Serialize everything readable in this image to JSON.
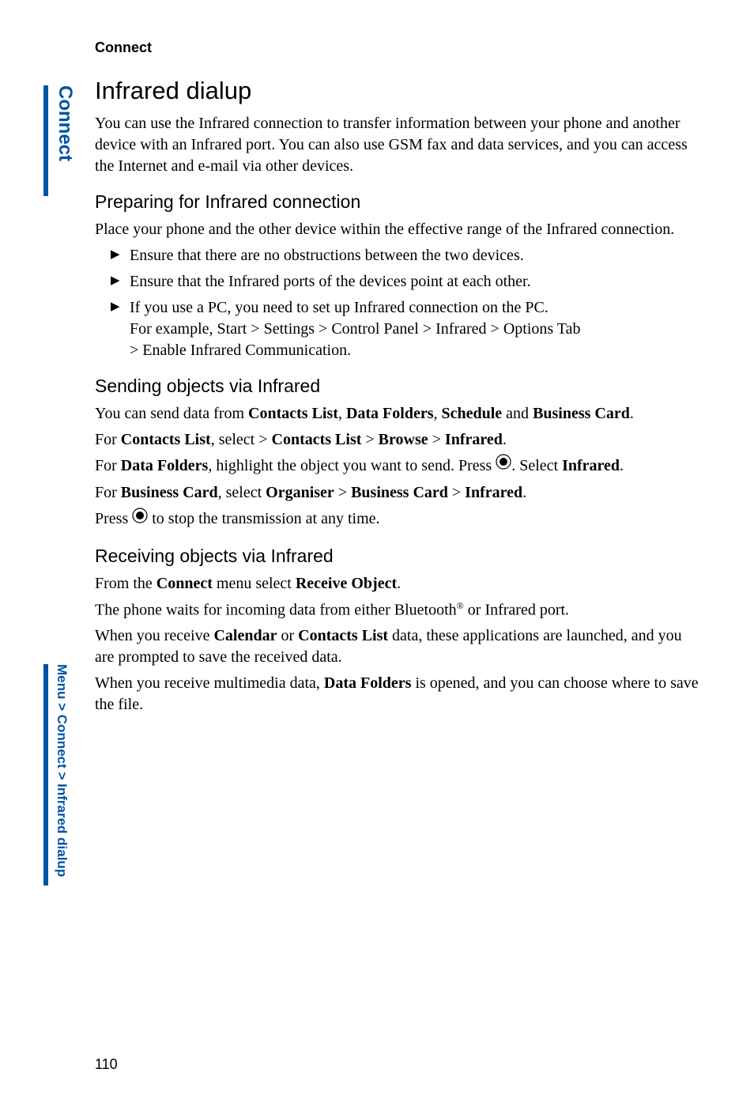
{
  "header": "Connect",
  "side_label_top": "Connect",
  "side_label_bottom": "Menu > Connect > Infrared dialup",
  "page_number": "110",
  "title": "Infrared dialup",
  "intro": "You can use the Infrared connection to transfer information between your phone and another device with an Infrared port. You can also use GSM fax and data services, and you can access the Internet and e-mail via other devices.",
  "sec1_title": "Preparing for Infrared connection",
  "sec1_p1": "Place your phone and the other device within the effective range of the Infrared connection.",
  "sec1_bullets": {
    "b1": "Ensure that there are no obstructions between the two devices.",
    "b2": "Ensure that the Infrared ports of the devices point at each other.",
    "b3_l1": "If you use a PC, you need to set up Infrared connection on the PC.",
    "b3_l2": "For example, Start > Settings > Control Panel > Infrared > Options Tab",
    "b3_l3": "> Enable Infrared Communication."
  },
  "sec2_title": "Sending objects via Infrared",
  "sec2": {
    "p1_pre": "You can send data from ",
    "p1_b1": "Contacts List",
    "p1_sep1": ", ",
    "p1_b2": "Data Folders",
    "p1_sep2": ", ",
    "p1_b3": "Schedule",
    "p1_and": " and ",
    "p1_b4": "Business Card",
    "p1_post": ".",
    "p2_pre": "For ",
    "p2_b1": "Contacts List",
    "p2_mid1": ", select > ",
    "p2_b2": "Contacts List",
    "p2_mid2": " > ",
    "p2_b3": "Browse",
    "p2_mid3": " > ",
    "p2_b4": "Infrared",
    "p2_post": ".",
    "p3_pre": "For ",
    "p3_b1": "Data Folders",
    "p3_mid1": ", highlight the object you want to send. Press ",
    "p3_mid2": ". Select ",
    "p3_b2": "Infrared",
    "p3_post": ".",
    "p4_pre": "For ",
    "p4_b1": "Business Card",
    "p4_mid1": ", select ",
    "p4_b2": "Organiser",
    "p4_mid2": " > ",
    "p4_b3": "Business Card",
    "p4_mid3": " > ",
    "p4_b4": "Infrared",
    "p4_post": ".",
    "p5_pre": "Press ",
    "p5_post": " to stop the transmission at any time."
  },
  "sec3_title": "Receiving objects via Infrared",
  "sec3": {
    "p1_pre": "From the ",
    "p1_b1": "Connect",
    "p1_mid": " menu select ",
    "p1_b2": "Receive Object",
    "p1_post": ".",
    "p2_pre": "The phone waits for incoming data from either Bluetooth",
    "p2_sup": "®",
    "p2_post": " or Infrared port.",
    "p3_pre": "When you receive ",
    "p3_b1": "Calendar",
    "p3_or": " or ",
    "p3_b2": "Contacts List",
    "p3_post": " data, these applications are launched, and you are prompted to save the received data.",
    "p4_pre": "When you receive multimedia data, ",
    "p4_b1": "Data Folders",
    "p4_post": " is opened, and you can choose where to save the file."
  }
}
